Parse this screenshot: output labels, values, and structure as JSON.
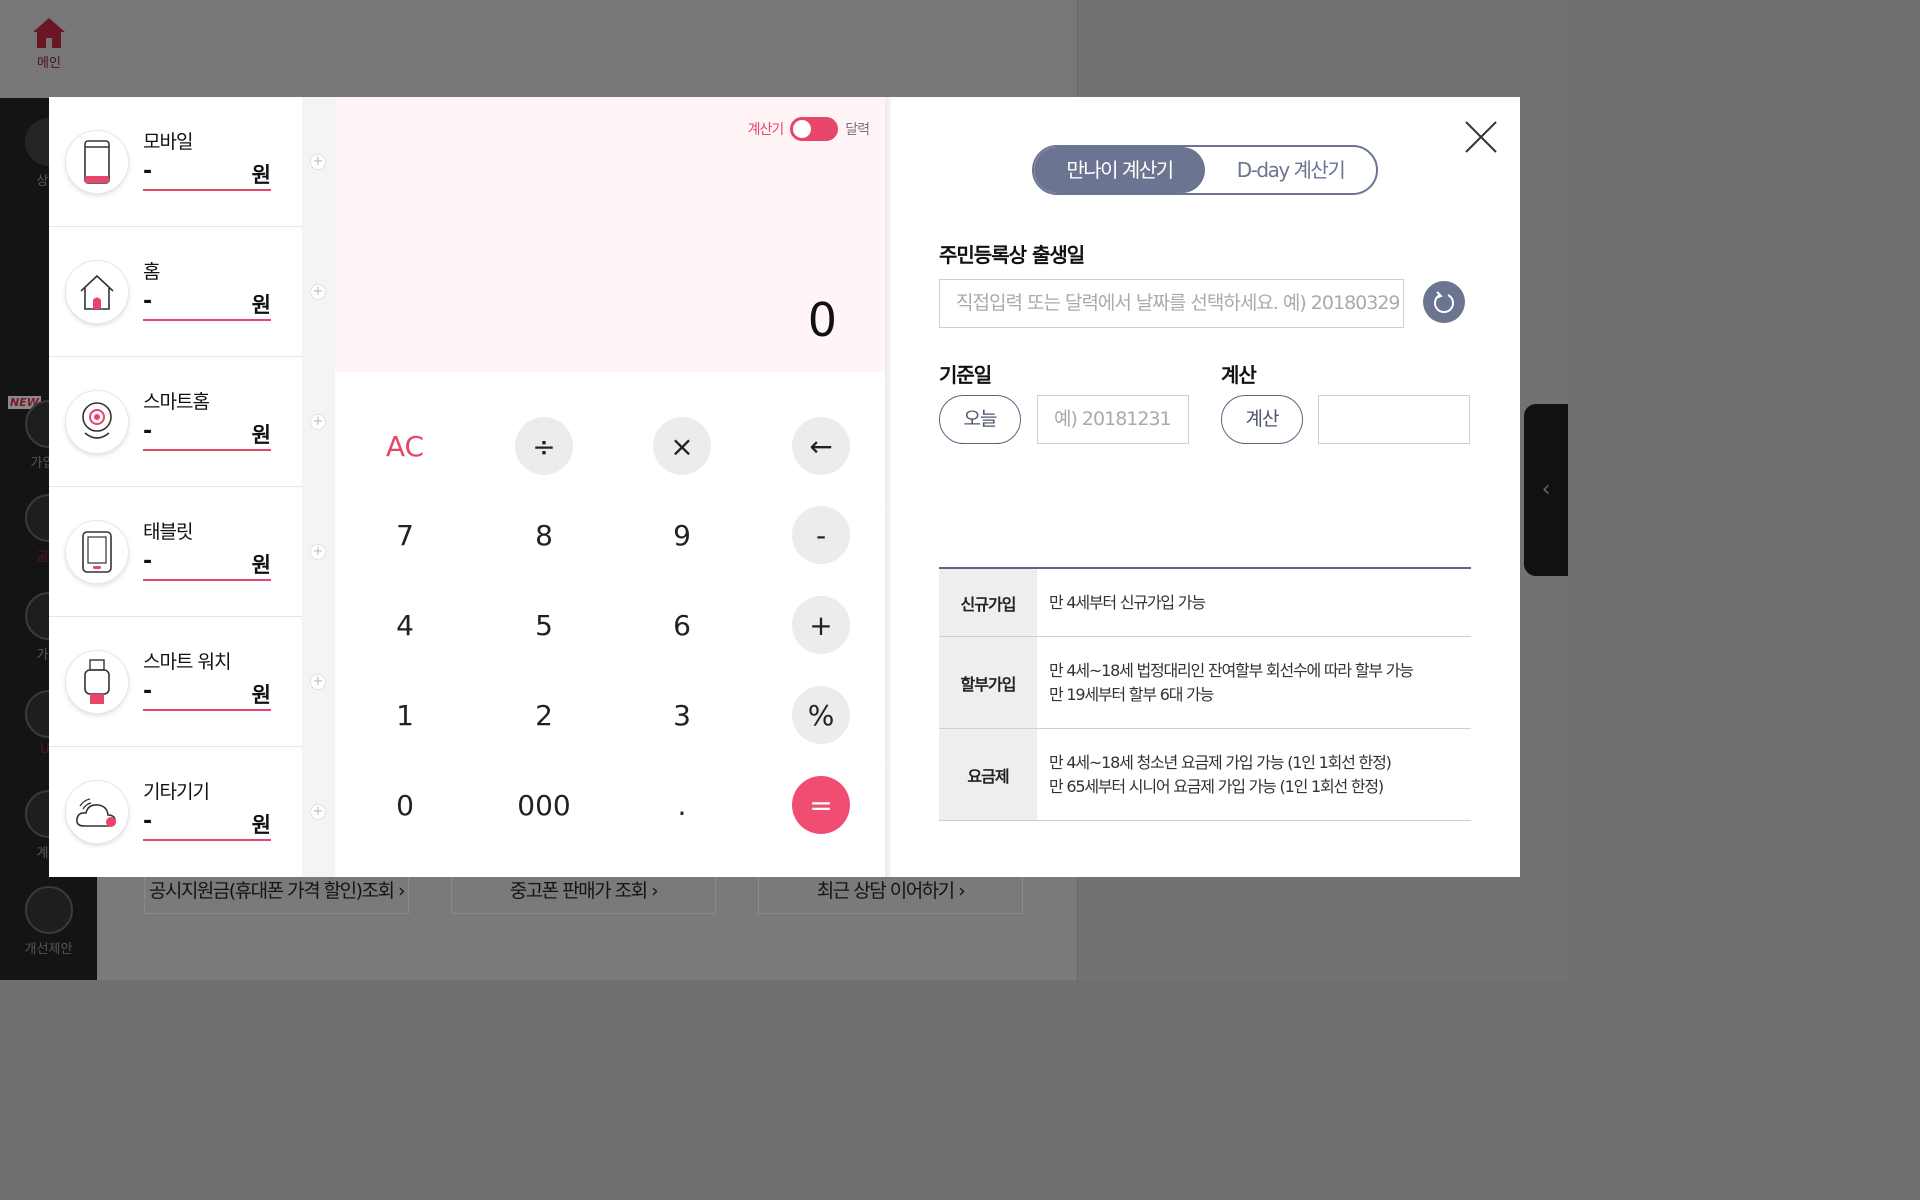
{
  "background": {
    "home_label": "메인",
    "side_items": [
      "상담",
      "가입정",
      "공지",
      "가이",
      "U⁺",
      "계산",
      "개선제안"
    ],
    "new_badge": "NEW",
    "bottom_links": [
      "공시지원금(휴대폰 가격 할인)조회 ›",
      "중고폰 판매가 조회 ›",
      "최근 상담 이어하기 ›"
    ],
    "right_tab_icon": "chevron-left-icon"
  },
  "devices": [
    {
      "name": "모바일",
      "value": "-",
      "unit": "원",
      "icon": "mobile-phone-icon"
    },
    {
      "name": "홈",
      "value": "-",
      "unit": "원",
      "icon": "house-icon"
    },
    {
      "name": "스마트홈",
      "value": "-",
      "unit": "원",
      "icon": "smart-camera-icon"
    },
    {
      "name": "태블릿",
      "value": "-",
      "unit": "원",
      "icon": "tablet-icon"
    },
    {
      "name": "스마트 워치",
      "value": "-",
      "unit": "원",
      "icon": "smartwatch-icon"
    },
    {
      "name": "기타기기",
      "value": "-",
      "unit": "원",
      "icon": "cloud-wireless-icon"
    }
  ],
  "add_button_label": "+",
  "calculator": {
    "mode_left": "계산기",
    "mode_right": "달력",
    "display": "0",
    "keys": {
      "ac": "AC",
      "divide": "÷",
      "multiply": "×",
      "backspace": "←",
      "seven": "7",
      "eight": "8",
      "nine": "9",
      "minus": "-",
      "four": "4",
      "five": "5",
      "six": "6",
      "plus": "+",
      "one": "1",
      "two": "2",
      "three": "3",
      "percent": "%",
      "zero": "0",
      "triple_zero": "000",
      "dot": ".",
      "equals": "="
    }
  },
  "age_calc": {
    "tabs": [
      "만나이 계산기",
      "D-day 계산기"
    ],
    "active_tab": 0,
    "birth_label": "주민등록상 출생일",
    "birth_placeholder": "직접입력 또는 달력에서 날짜를 선택하세요. 예) 20180329",
    "base_label": "기준일",
    "today_button": "오늘",
    "base_placeholder": "예) 20181231",
    "calc_label": "계산",
    "calc_button": "계산",
    "result_value": "",
    "info": [
      {
        "head": "신규가입",
        "lines": [
          "만 4세부터 신규가입 가능"
        ]
      },
      {
        "head": "할부가입",
        "lines": [
          "만 4세~18세 법정대리인 잔여할부 회선수에 따라 할부 가능",
          "만 19세부터 할부 6대 가능"
        ]
      },
      {
        "head": "요금제",
        "lines": [
          "만 4세~18세 청소년 요금제 가입 가능 (1인 1회선 한정)",
          "만 65세부터 시니어 요금제 가입 가능 (1인 1회선 한정)"
        ]
      }
    ]
  },
  "colors": {
    "accent": "#e8456a",
    "navy": "#6b7591",
    "display_bg": "#fff5f6"
  }
}
